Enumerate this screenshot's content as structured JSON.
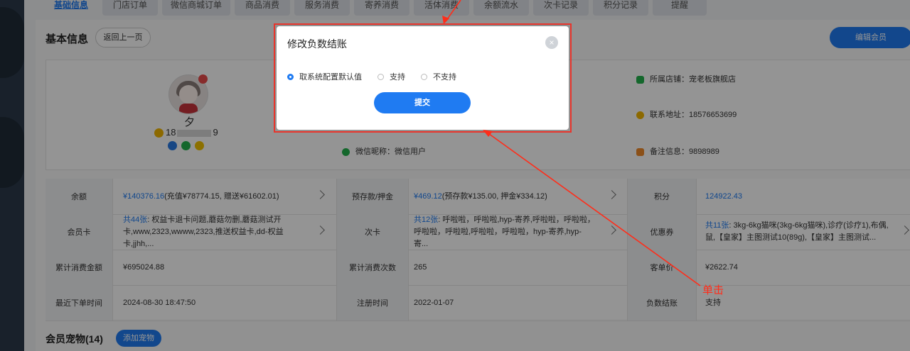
{
  "tabs": [
    "基础信息",
    "门店订单",
    "微信商城订单",
    "商品消费",
    "服务消费",
    "寄养消费",
    "活体消费",
    "余额流水",
    "次卡记录",
    "积分记录",
    "提醒"
  ],
  "header": {
    "title": "基本信息",
    "back_label": "返回上一页",
    "edit_label": "编辑会员"
  },
  "profile": {
    "nickname": "夕",
    "phone_prefix": "18",
    "phone_suffix": "9",
    "wechat_nickname": "微信昵称：微信用户",
    "store": "所属店铺：宠老板旗舰店",
    "contact": "联系地址：18576653699",
    "remark": "备注信息：9898989"
  },
  "stats": {
    "balance_label": "余额",
    "balance_value": "¥140376.16",
    "balance_detail": " (充值¥78774.15, 赠送¥61602.01)",
    "prepaid_label": "预存款/押金",
    "prepaid_value": "¥469.12",
    "prepaid_detail": " (预存款¥135.00, 押金¥334.12)",
    "points_label": "积分",
    "points_value": "124922.43",
    "card_label": "会员卡",
    "card_count": "共44张",
    "card_detail": ": 权益卡退卡问题,蘑菇勿删,蘑菇测试开卡,www,2323,wwww,2323,推送权益卡,dd-权益卡,jjhh,...",
    "times_label": "次卡",
    "times_count": "共12张",
    "times_detail": ": 呼啦啦，呼啦啦,hyp-寄养,呼啦啦，呼啦啦，呼啦啦，呼啦啦,呼啦啦，呼啦啦，hyp-寄养,hyp-寄...",
    "coupon_label": "优惠券",
    "coupon_count": "共11张",
    "coupon_detail": ": 3kg-6kg猫咪(3kg-6kg猫咪),诊疗(诊疗1),布偶,鼠,【皇家】主图测试10(89g),【皇家】主图测试...",
    "total_amount_label": "累计消费金额",
    "total_amount_value": "¥695024.88",
    "total_count_label": "累计消费次数",
    "total_count_value": "265",
    "avg_label": "客单价",
    "avg_value": "¥2622.74",
    "last_order_label": "最近下单时间",
    "last_order_value": "2024-08-30 18:47:50",
    "register_label": "注册时间",
    "register_value": "2022-01-07",
    "negative_label": "负数结账",
    "negative_value": "支持"
  },
  "pets": {
    "title": "会员宠物(14)",
    "add_label": "添加宠物"
  },
  "modal": {
    "title": "修改负数结账",
    "close": "×",
    "options": [
      "取系统配置默认值",
      "支持",
      "不支持"
    ],
    "selected_index": 0,
    "submit_label": "提交"
  },
  "annotation": "单击",
  "colors": {
    "accent": "#1f7bf2",
    "annotation_red": "#ff2d1a"
  }
}
